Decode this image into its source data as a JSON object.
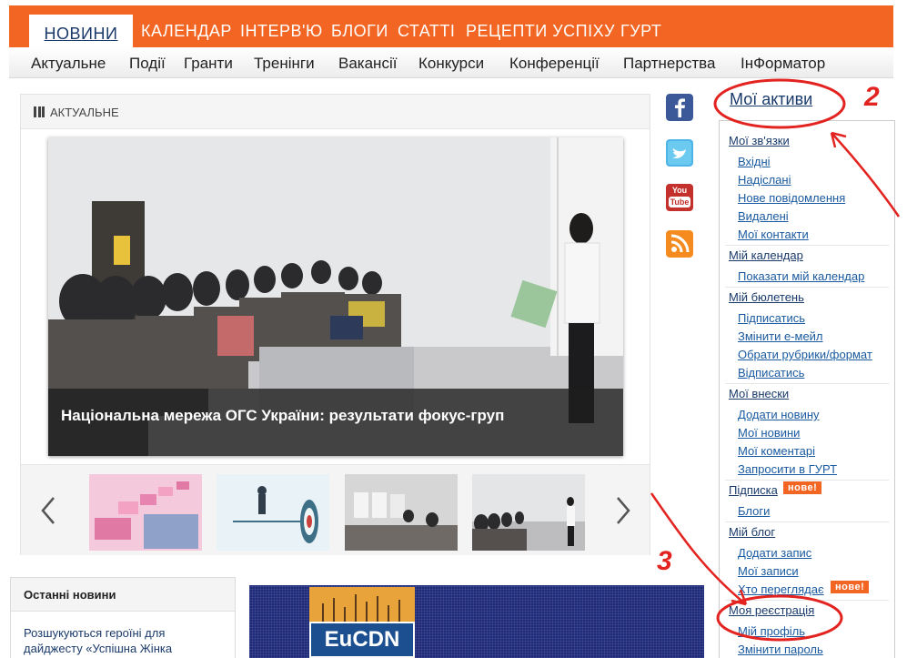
{
  "top_nav": {
    "active": "НОВИНИ",
    "tabs": [
      "КАЛЕНДАР",
      "ІНТЕРВ'Ю",
      "БЛОГИ",
      "СТАТТІ",
      "РЕЦЕПТИ УСПІХУ",
      "ГУРТ"
    ]
  },
  "sub_nav": [
    "Актуальне",
    "Події",
    "Гранти",
    "Тренінги",
    "Вакансії",
    "Конкурси",
    "Конференції",
    "Партнерства",
    "ІнФорматор"
  ],
  "slider": {
    "header": "АКТУАЛЬНЕ",
    "caption": "Національна мережа ОГС України: результати фокус-груп"
  },
  "social": [
    "facebook-icon",
    "twitter-icon",
    "youtube-icon",
    "rss-icon"
  ],
  "youtube_text": {
    "you": "You",
    "tube": "Tube"
  },
  "sidebar": {
    "title": "Мої активи",
    "sections": [
      {
        "heading": "Мої зв'язки",
        "items": [
          "Вхідні",
          "Надіслані",
          "Нове повідомлення",
          "Видалені",
          "Мої контакти"
        ]
      },
      {
        "heading": "Мій календар",
        "items": [
          "Показати мій календар"
        ]
      },
      {
        "heading": "Мій бюлетень",
        "items": [
          "Підписатись",
          "Змінити е-мейл",
          "Обрати рубрики/формат",
          "Відписатись"
        ]
      },
      {
        "heading": "Мої внески",
        "items": [
          "Додати новину",
          "Мої новини",
          "Мої коментарі",
          "Запросити в ГУРТ"
        ]
      },
      {
        "heading": "Підписка",
        "items": [
          "Блоги"
        ]
      },
      {
        "heading": "Мій блог",
        "items": [
          "Додати запис",
          "Мої записи",
          "Хто переглядає"
        ]
      },
      {
        "heading": "Моя реєстрація",
        "items": [
          "Мій профіль",
          "Змінити пароль"
        ]
      }
    ],
    "badge": "нове!"
  },
  "latest_news": {
    "title": "Останні новини",
    "item": "Розшукуються героїні для дайджесту «Успішна Жінка"
  },
  "banner": {
    "logo_text": "EuCDN"
  },
  "annotations": {
    "n2": "2",
    "n3": "3"
  },
  "colors": {
    "accent": "#f26522",
    "link": "#1a3a6b",
    "annotation": "#e3231f"
  }
}
